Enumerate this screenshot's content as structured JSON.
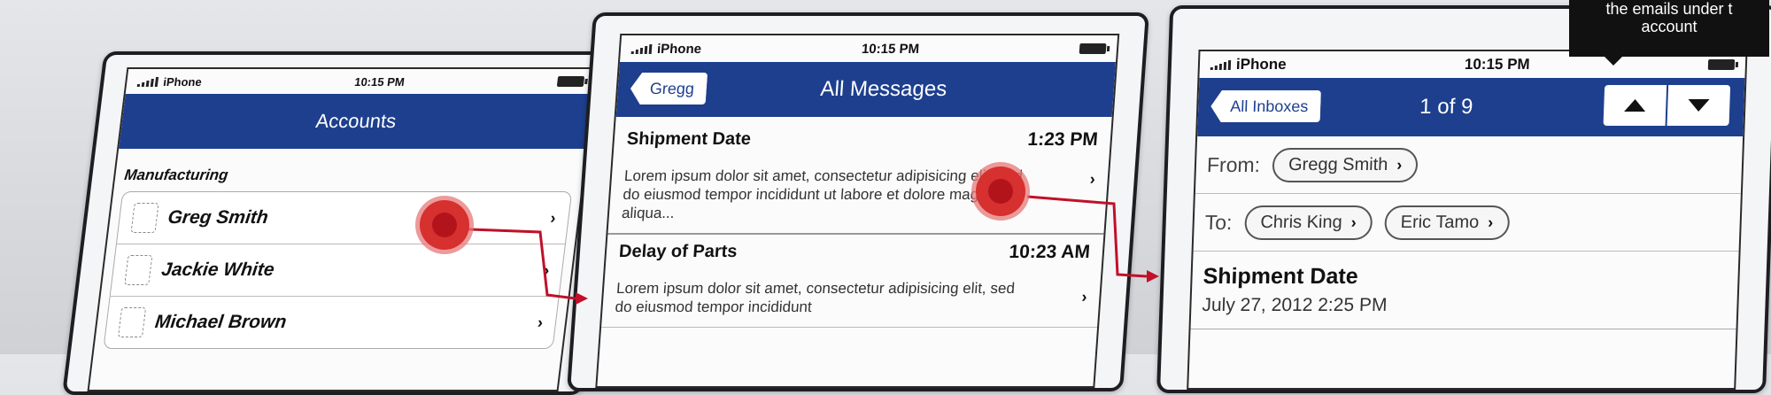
{
  "phone1": {
    "status": {
      "carrier": "iPhone",
      "time": "10:15 PM"
    },
    "nav_title": "Accounts",
    "section": "Manufacturing",
    "accounts": [
      {
        "name": "Greg Smith"
      },
      {
        "name": "Jackie White"
      },
      {
        "name": "Michael Brown"
      }
    ]
  },
  "phone2": {
    "status": {
      "carrier": "iPhone",
      "time": "10:15 PM"
    },
    "back_label": "Gregg",
    "nav_title": "All Messages",
    "messages": [
      {
        "subject": "Shipment Date",
        "time": "1:23 PM",
        "preview": "Lorem ipsum dolor sit amet, consectetur adipisicing elit, sed do eiusmod tempor incididunt ut labore et dolore magna aliqua..."
      },
      {
        "subject": "Delay of Parts",
        "time": "10:23 AM",
        "preview": "Lorem ipsum dolor sit amet, consectetur adipisicing elit, sed do eiusmod tempor incididunt"
      }
    ]
  },
  "phone3": {
    "status": {
      "carrier": "iPhone",
      "time": "10:15 PM"
    },
    "back_label": "All Inboxes",
    "counter": "1 of 9",
    "from_label": "From:",
    "from": "Gregg Smith",
    "to_label": "To:",
    "to": [
      "Chris King",
      "Eric Tamo"
    ],
    "subject": "Shipment Date",
    "date": "July 27, 2012 2:25 PM"
  },
  "tooltip": {
    "line1": "the emails under t",
    "line2": "account"
  },
  "colors": {
    "navbar": "#1d3f8e",
    "hotspot": "#d6302f",
    "connector": "#c0102a"
  }
}
